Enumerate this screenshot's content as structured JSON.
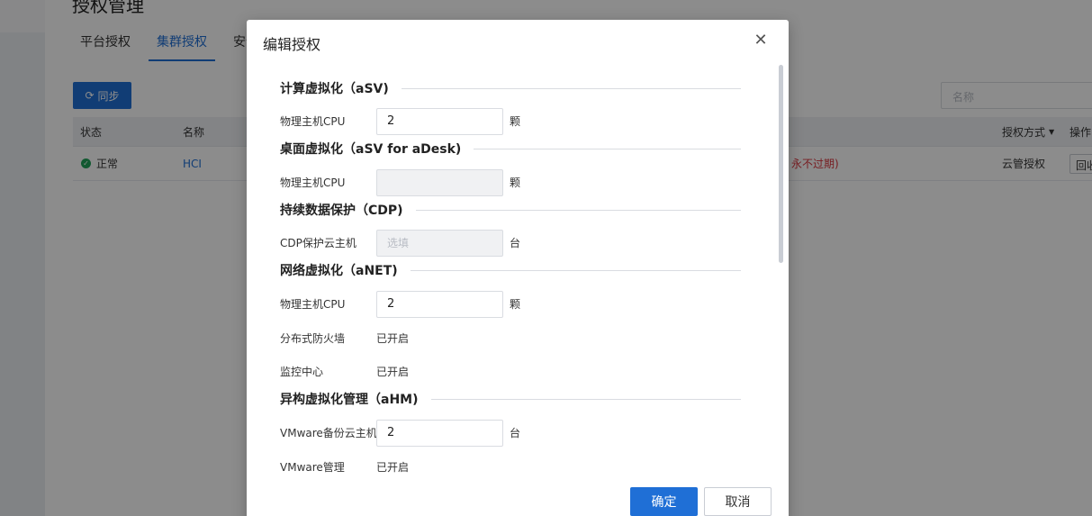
{
  "background": {
    "page_title": "授权管理",
    "tabs": [
      {
        "label": "平台授权",
        "active": false
      },
      {
        "label": "集群授权",
        "active": true
      },
      {
        "label": "安全",
        "active": false
      }
    ],
    "sync_button": "同步",
    "search_placeholder": "名称",
    "table": {
      "headers": [
        "状态",
        "名称",
        "授权方式",
        "操作"
      ],
      "row": {
        "status": "正常",
        "name": "HCI",
        "expiry_suffix": "永不过期)",
        "auth_method": "云管授权",
        "action": "回收"
      }
    }
  },
  "modal": {
    "title": "编辑授权",
    "sections": [
      {
        "title": "计算虚拟化（aSV)",
        "rows": [
          {
            "label": "物理主机CPU",
            "type": "input",
            "value": "2",
            "unit": "颗"
          }
        ]
      },
      {
        "title": "桌面虚拟化（aSV for aDesk)",
        "rows": [
          {
            "label": "物理主机CPU",
            "type": "disabled",
            "value": "",
            "unit": "颗"
          }
        ]
      },
      {
        "title": "持续数据保护（CDP)",
        "rows": [
          {
            "label": "CDP保护云主机",
            "type": "disabled",
            "placeholder": "选填",
            "unit": "台"
          }
        ]
      },
      {
        "title": "网络虚拟化（aNET)",
        "rows": [
          {
            "label": "物理主机CPU",
            "type": "input",
            "value": "2",
            "unit": "颗"
          },
          {
            "label": "分布式防火墙",
            "type": "text",
            "value": "已开启"
          },
          {
            "label": "监控中心",
            "type": "text",
            "value": "已开启"
          }
        ]
      },
      {
        "title": "异构虚拟化管理（aHM)",
        "rows": [
          {
            "label": "VMware备份云主机",
            "type": "input",
            "value": "2",
            "unit": "台"
          },
          {
            "label": "VMware管理",
            "type": "text",
            "value": "已开启"
          }
        ]
      }
    ],
    "confirm_label": "确定",
    "cancel_label": "取消"
  }
}
